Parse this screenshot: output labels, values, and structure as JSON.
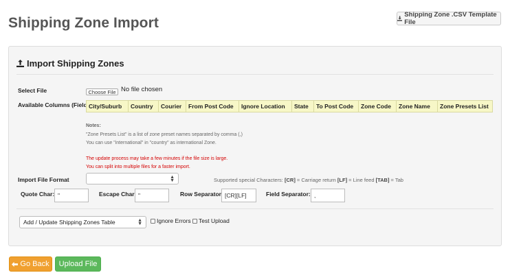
{
  "page": {
    "title": "Shipping Zone Import",
    "template_button": "Shipping Zone .CSV Template File"
  },
  "panel": {
    "title": "Import Shipping Zones",
    "select_file_label": "Select File",
    "choose_file_button": "Choose File",
    "no_file_text": "No file chosen",
    "available_columns_label": "Available Columns (Fields)",
    "columns": [
      "City/Suburb",
      "Country",
      "Courier",
      "From Post Code",
      "Ignore Location",
      "State",
      "To Post Code",
      "Zone Code",
      "Zone Name",
      "Zone Presets List"
    ],
    "notes_title": "Notes:",
    "notes": [
      "\"Zone Presets List\" is a list of zone preset names separated by comma (,)",
      "You can use \"international\" in \"country\" as international Zone."
    ],
    "warnings": [
      "The update process may take a few minutes if the file size is large.",
      "You can split into multiple files for a faster import."
    ],
    "import_format_label": "Import File Format",
    "import_format_value": "",
    "supported": {
      "prefix": "Supported special Characters:",
      "cr_code": "[CR]",
      "cr_desc": "= Carriage return",
      "lf_code": "[LF]",
      "lf_desc": "= Line feed",
      "tab_code": "[TAB]",
      "tab_desc": "= Tab"
    },
    "quote_char_label": "Quote Char:",
    "quote_char_value": "\"",
    "escape_char_label": "Escape Char:",
    "escape_char_value": "\"",
    "row_separator_label": "Row Separator:",
    "row_separator_value": "[CR][LF]",
    "field_separator_label": "Field Separator:",
    "field_separator_value": ",",
    "action_select_value": "Add / Update Shipping Zones Table",
    "ignore_errors_label": "Ignore Errors",
    "test_upload_label": "Test Upload"
  },
  "footer": {
    "back_button": "Go Back",
    "upload_button": "Upload File"
  },
  "colors": {
    "back_button": "#f0a030",
    "upload_button": "#5cb85c",
    "columns_header_bg": "#f7f7c7",
    "warning_text": "#d40000"
  },
  "icons": {
    "template_button": "download-icon",
    "panel_title": "upload-icon",
    "back_button": "arrow-left-icon"
  }
}
